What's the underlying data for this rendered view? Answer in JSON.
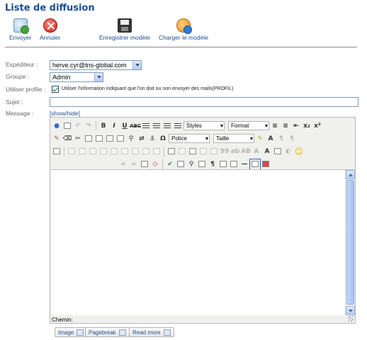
{
  "page_title": "Liste de diffusion",
  "toolbar": {
    "send": "Envoyer",
    "cancel": "Annuler",
    "save_model": "Enregistrer modèle",
    "load_model": "Charger le modèle"
  },
  "form": {
    "sender_label": "Expéditeur :",
    "sender_value": "herve.cyr@tns-global.com",
    "group_label": "Groupe :",
    "group_value": "Admin",
    "use_profile_label": "Utiliser profile :",
    "use_profile_text": "Utiliser l'information indiquant que l'on doit ou non envoyer des mails(PROFIL)",
    "subject_label": "Sujet :",
    "subject_value": "",
    "message_label": "Message :",
    "showhide": "[show/hide]"
  },
  "editor": {
    "styles": "Styles",
    "format": "Format",
    "font": "Police",
    "size": "Taille",
    "path_label": "Chemin:"
  },
  "bottom_buttons": {
    "image": "Image",
    "pagebreak": "Pagebreak",
    "readmore": "Read more"
  }
}
